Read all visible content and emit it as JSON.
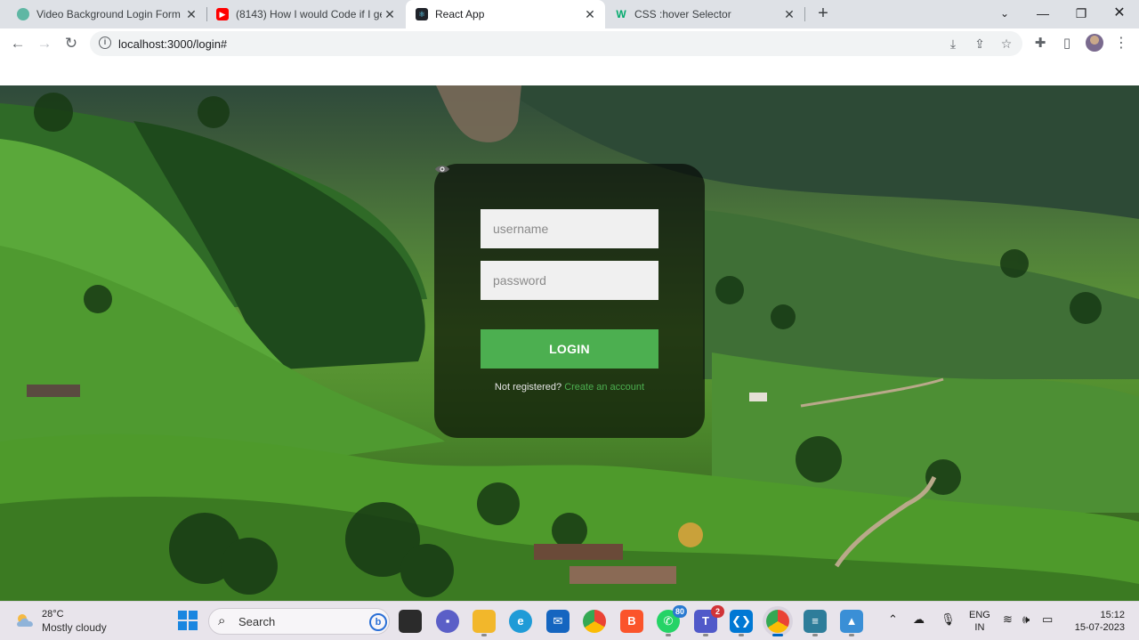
{
  "browser": {
    "tabs": [
      {
        "title": "Video Background Login Form",
        "active": false
      },
      {
        "title": "(8143) How I would Code if I get",
        "active": false
      },
      {
        "title": "React App",
        "active": true
      },
      {
        "title": "CSS :hover Selector",
        "active": false
      }
    ],
    "url": "localhost:3000/login#",
    "colors": {
      "tabstrip": "#dee1e6",
      "omnibox": "#f1f3f4"
    }
  },
  "login": {
    "username_placeholder": "username",
    "password_placeholder": "password",
    "login_label": "LOGIN",
    "register_text": "Not registered?",
    "register_link": "Create an account",
    "colors": {
      "accent": "#4caf50",
      "card": "rgba(0,0,0,0.62)"
    }
  },
  "taskbar": {
    "weather": {
      "temp": "28°C",
      "desc": "Mostly cloudy"
    },
    "search_placeholder": "Search",
    "whatsapp_badge": "80",
    "teams_badge": "2",
    "lang": {
      "line1": "ENG",
      "line2": "IN"
    },
    "time": "15:12",
    "date": "15-07-2023"
  }
}
